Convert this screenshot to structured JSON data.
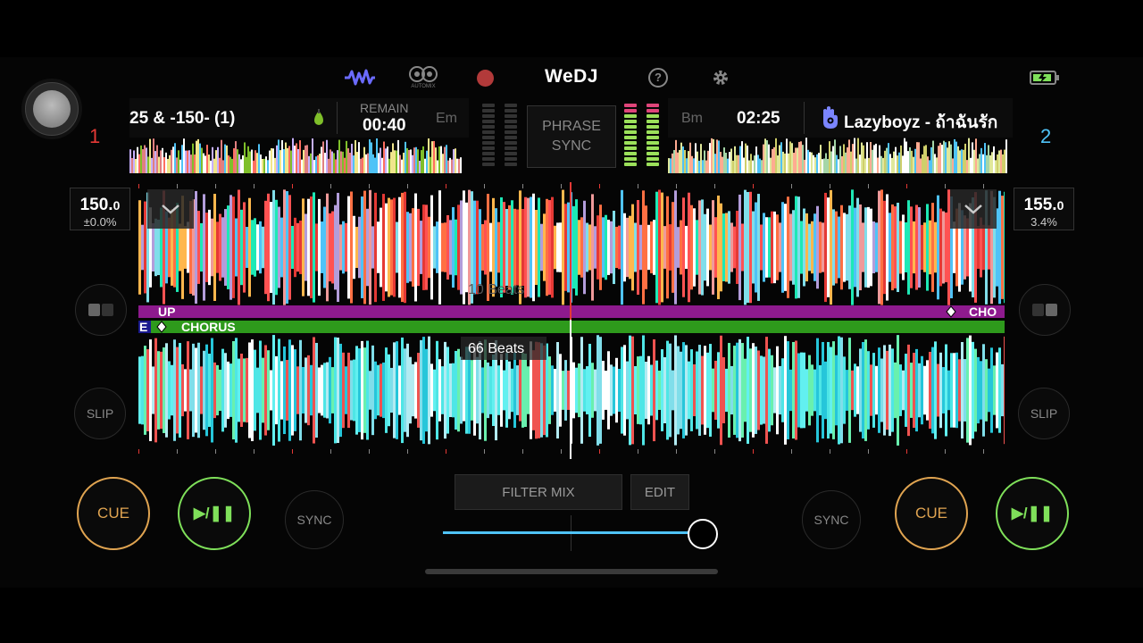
{
  "top_bar": {
    "brand": "WeDJ",
    "automix_label": "AUTOMIX",
    "icons": [
      "waveform-icon",
      "automix-icon",
      "record-icon",
      "help-icon",
      "settings-icon",
      "battery-icon"
    ]
  },
  "deck1": {
    "number": "1",
    "track_title": "25 & -150- (1)",
    "remain_label": "REMAIN",
    "time": "00:40",
    "key": "Em",
    "bpm": "150.",
    "bpm_decimal": "0",
    "pitch": "±0.0%",
    "phrase_left": "UP",
    "cue_label": "CUE",
    "play_label": "▶/❚❚",
    "sync_label": "SYNC",
    "slip_label": "SLIP",
    "beats_label": "10 Beats"
  },
  "deck2": {
    "number": "2",
    "track_title": "Lazyboyz - ถ้าฉันรัก",
    "time": "02:25",
    "key": "Bm",
    "bpm": "155.",
    "bpm_decimal": "0",
    "pitch": "3.4%",
    "phrase_left": "E",
    "phrase_main": "CHORUS",
    "phrase_right_top": "CHO",
    "cue_label": "CUE",
    "play_label": "▶/❚❚",
    "sync_label": "SYNC",
    "slip_label": "SLIP",
    "beats_label": "66 Beats"
  },
  "center": {
    "phrase_sync": [
      "PHRASE",
      "SYNC"
    ],
    "filter_mix": "FILTER MIX",
    "edit": "EDIT",
    "crossfader_position": 0.97
  },
  "colors": {
    "deck1": "#e53935",
    "deck2": "#4fc3f7",
    "cue": "#e0a451",
    "play": "#7fe05a",
    "phrase_purple": "#8e1a8e",
    "phrase_green": "#2e9a1c"
  }
}
